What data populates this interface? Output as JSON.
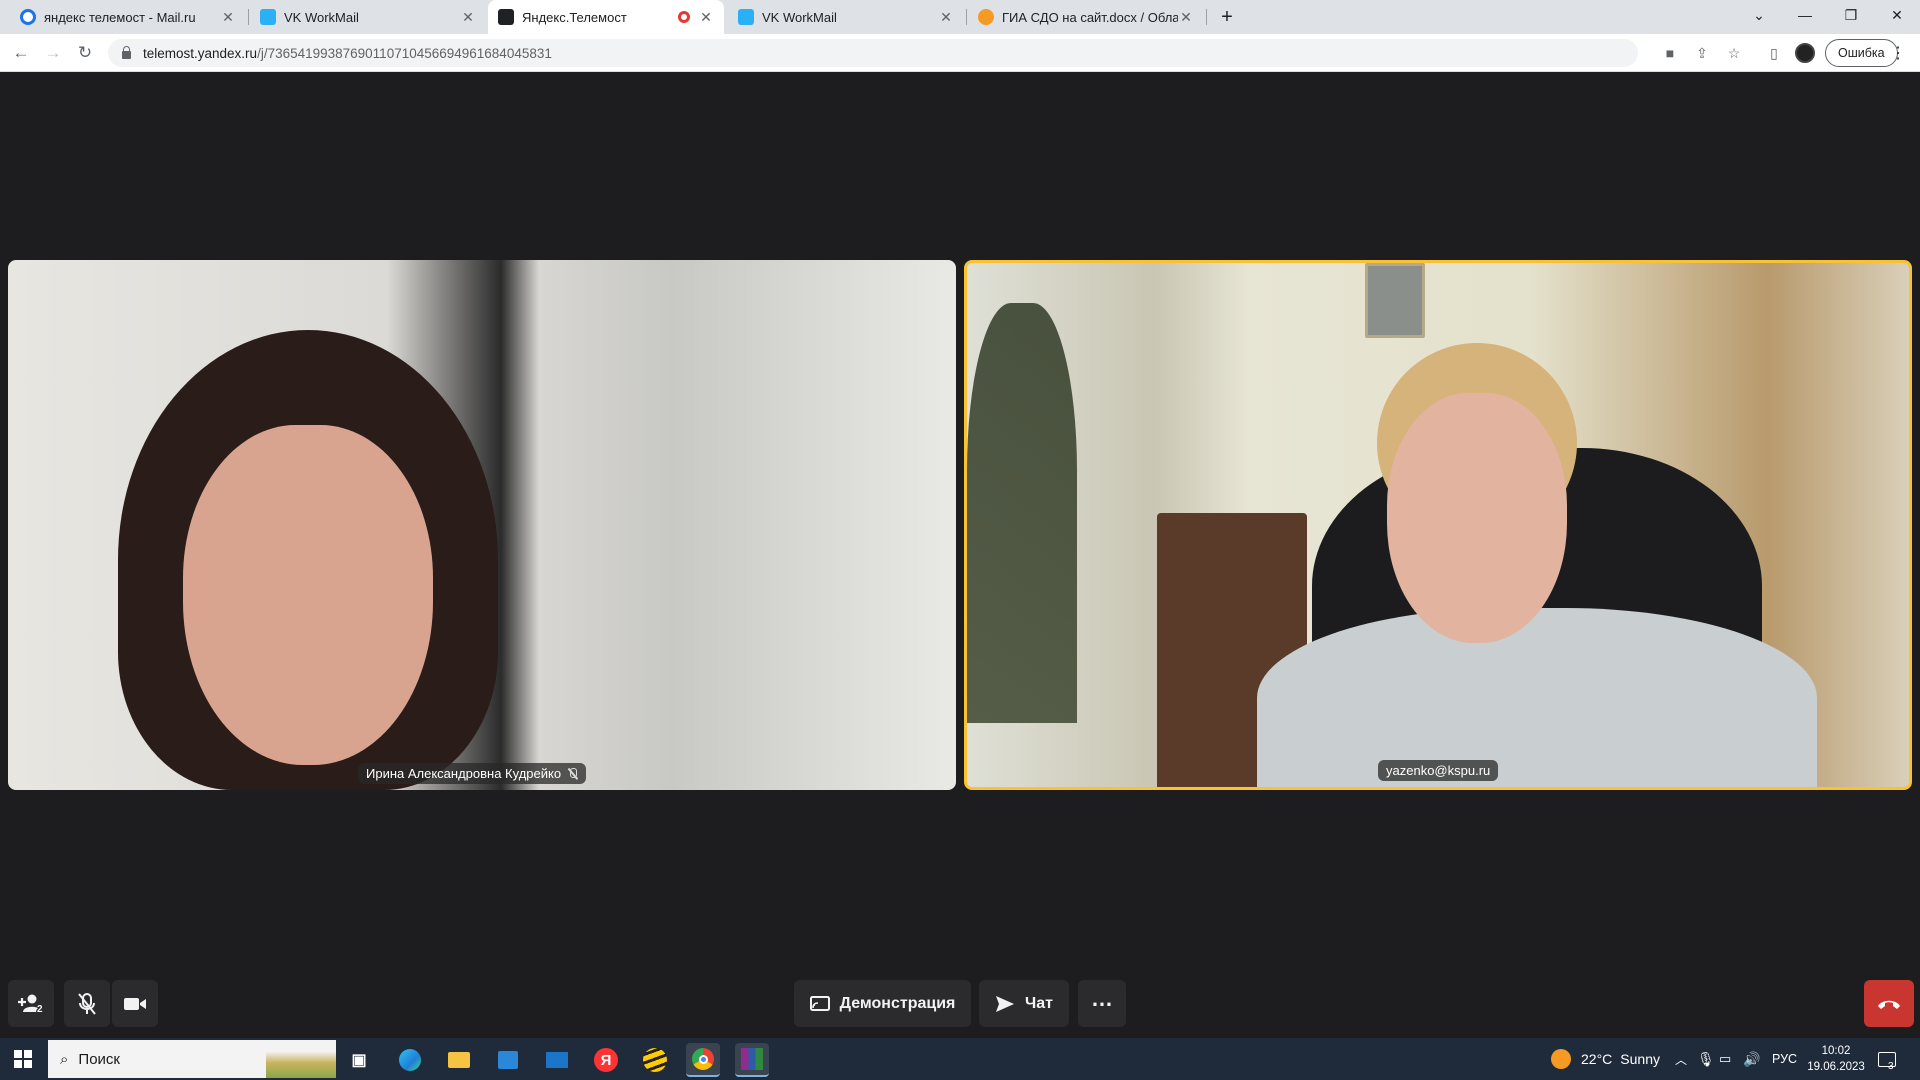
{
  "browser": {
    "tabs": [
      {
        "title": "яндекс телемост - Mail.ru",
        "favicon_color": "#1a73e8",
        "active": false
      },
      {
        "title": "VK WorkMail",
        "favicon_color": "#2ab0f5",
        "active": false
      },
      {
        "title": "Яндекс.Телемост",
        "favicon_color": "#202124",
        "active": true,
        "recording": true
      },
      {
        "title": "VK WorkMail",
        "favicon_color": "#2ab0f5",
        "active": false
      },
      {
        "title": "ГИА СДО на сайт.docx / Облако",
        "favicon_color": "#f59a23",
        "active": false
      }
    ],
    "new_tab_label": "+",
    "url_domain": "telemost.yandex.ru",
    "url_path": "/j/73654199387690110710456694961684045831",
    "error_label": "Ошибка"
  },
  "meeting": {
    "participants": [
      {
        "name": "Ирина Александровна Кудрейко",
        "muted": true,
        "speaking": false
      },
      {
        "name": "yazenko@kspu.ru",
        "muted": false,
        "speaking": true
      }
    ],
    "participant_count": "2",
    "controls": {
      "screen_share_label": "Демонстрация",
      "chat_label": "Чат"
    },
    "accent_color": "#f8c234",
    "hangup_color": "#c9362f"
  },
  "taskbar": {
    "search_placeholder": "Поиск",
    "weather_temp": "22°C",
    "weather_text": "Sunny",
    "language": "РУС",
    "time": "10:02",
    "date": "19.06.2023",
    "notification_count": "3",
    "apps": [
      "task-view-icon",
      "edge-icon",
      "file-explorer-icon",
      "store-icon",
      "mail-icon",
      "yandex-browser-icon",
      "beeline-icon",
      "chrome-icon",
      "winrar-icon"
    ]
  }
}
